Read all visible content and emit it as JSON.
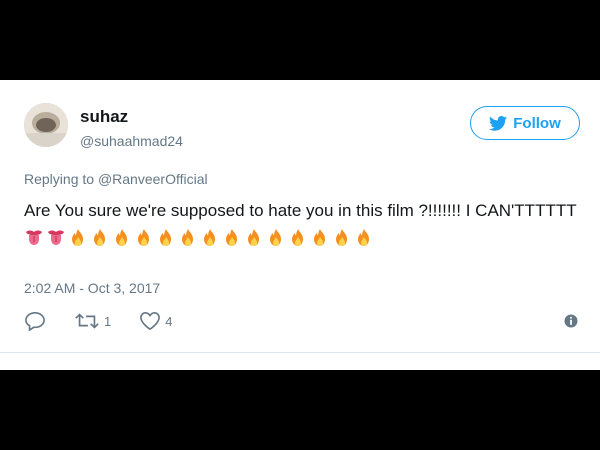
{
  "tweet": {
    "name": "suhaz",
    "handle": "@suhaahmad24",
    "follow_label": "Follow",
    "replying_prefix": "Replying to ",
    "replying_to": "@RanveerOfficial",
    "text": "Are You sure we're supposed to hate you in this film ?!!!!!!! I CAN'TTTTTT",
    "emojis": [
      "tongue",
      "tongue",
      "fire",
      "fire",
      "fire",
      "fire",
      "fire",
      "fire",
      "fire",
      "fire",
      "fire",
      "fire",
      "fire",
      "fire",
      "fire",
      "fire"
    ],
    "timestamp": "2:02 AM - Oct 3, 2017",
    "retweets": "1",
    "likes": "4"
  },
  "icons": {
    "reply": "reply-icon",
    "retweet": "retweet-icon",
    "like": "heart-icon",
    "info": "info-icon",
    "follow": "twitter-bird-icon"
  },
  "colors": {
    "accent": "#1da1f2",
    "secondary_text": "#657786",
    "primary_text": "#14171a",
    "frame": "#000000"
  }
}
